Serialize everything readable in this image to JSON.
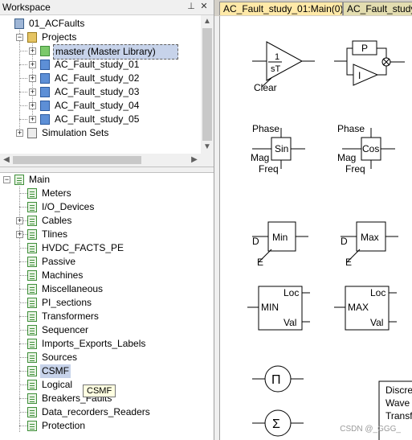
{
  "workspace": {
    "title": "Workspace",
    "root": "01_ACFaults",
    "projects_label": "Projects",
    "projects": [
      "master (Master Library)",
      "AC_Fault_study_01",
      "AC_Fault_study_02",
      "AC_Fault_study_03",
      "AC_Fault_study_04",
      "AC_Fault_study_05"
    ],
    "simulation_sets": "Simulation Sets"
  },
  "library_tree": {
    "root": "Main",
    "items": [
      "Meters",
      "I/O_Devices",
      "Cables",
      "Tlines",
      "HVDC_FACTS_PE",
      "Passive",
      "Machines",
      "Miscellaneous",
      "PI_sections",
      "Transformers",
      "Sequencer",
      "Imports_Exports_Labels",
      "Sources",
      "CSMF",
      "Logical",
      "Breakers_Faults",
      "Data_recorders_Readers",
      "Protection"
    ],
    "selected": "CSMF",
    "tooltip": "CSMF"
  },
  "tabs": [
    "AC_Fault_study_01:Main(0)",
    "AC_Fault_study_"
  ],
  "canvas": {
    "integrator": {
      "num": "1",
      "den": "sT",
      "clear": "Clear"
    },
    "pi": {
      "p": "P",
      "i": "I"
    },
    "sin": {
      "name": "Sin",
      "phase": "Phase",
      "mag": "Mag",
      "freq": "Freq"
    },
    "cos": {
      "name": "Cos",
      "phase": "Phase",
      "mag": "Mag",
      "freq": "Freq"
    },
    "min": {
      "name": "Min",
      "d": "D",
      "e": "E"
    },
    "max": {
      "name": "Max",
      "d": "D",
      "e": "E"
    },
    "min_loc": {
      "name": "MIN",
      "loc": "Loc",
      "val": "Val"
    },
    "max_loc": {
      "name": "MAX",
      "loc": "Loc",
      "val": "Val"
    },
    "product": "Π",
    "sum": "Σ",
    "partial_block": [
      "Discre",
      "Wave",
      "Transf"
    ]
  },
  "watermark": "CSDN @_GGG_"
}
